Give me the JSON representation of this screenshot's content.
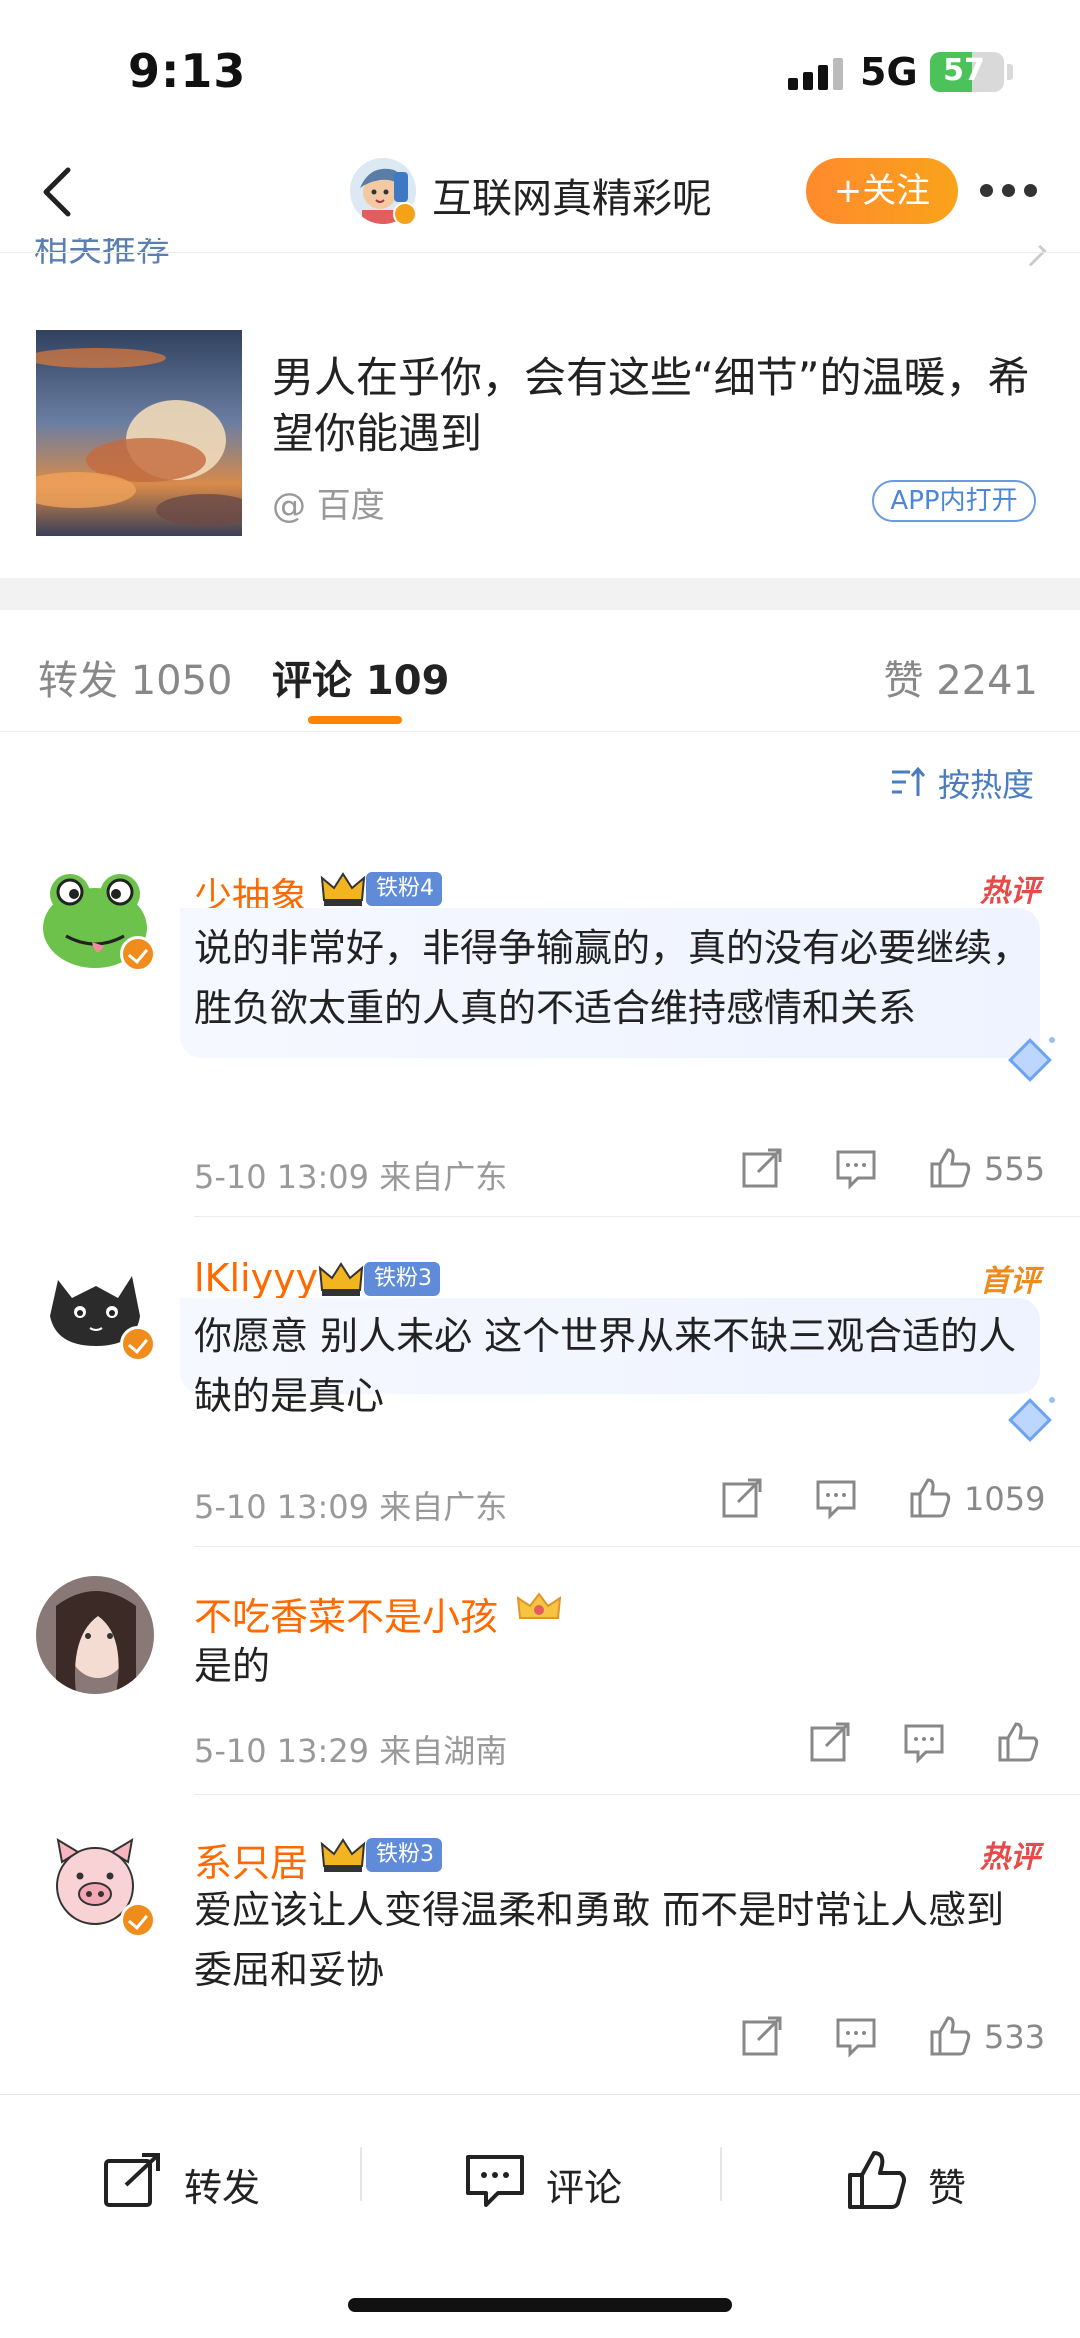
{
  "status_bar": {
    "time": "9:13",
    "network": "5G",
    "battery_level": "57",
    "battery_fraction": 0.57,
    "battery_color": "#4cc35a"
  },
  "nav": {
    "title": "互联网真精彩呢",
    "follow_label": "+关注",
    "follow_color": "#ff8a2c"
  },
  "related": {
    "header_partial": "相关推荐"
  },
  "recommendation": {
    "title": "男人在乎你，会有这些“细节”的温暖，希望你能遇到",
    "source": "@ 百度",
    "open_app_label": "APP内打开"
  },
  "tabs": {
    "repost": "转发 1050",
    "comments": "评论 109",
    "likes": "赞 2241",
    "active_color": "#ff8200"
  },
  "sort": {
    "label": "按热度"
  },
  "comments": [
    {
      "name": "少抽象",
      "fan_badge": "铁粉4",
      "hot_label": "热评",
      "text": "说的非常好，非得争输赢的，真的没有必要继续，胜负欲太重的人真的不适合维持感情和关系",
      "meta": "5-10 13:09 来自广东",
      "likes": "555"
    },
    {
      "name": "lKliyyy",
      "fan_badge": "铁粉3",
      "hot_label": "首评",
      "text": "你愿意 别人未必 这个世界从来不缺三观合适的人 缺的是真心",
      "meta": "5-10 13:09 来自广东",
      "likes": "1059"
    },
    {
      "name": "不吃香菜不是小孩",
      "text": "是的",
      "meta": "5-10 13:29 来自湖南",
      "likes": ""
    },
    {
      "name": "系只居",
      "fan_badge": "铁粉3",
      "hot_label": "热评",
      "text": "爱应该让人变得温柔和勇敢 而不是时常让人感到委屈和妥协",
      "meta": "",
      "likes": "533"
    }
  ],
  "bottom_bar": {
    "repost": "转发",
    "comment": "评论",
    "like": "赞"
  },
  "colors": {
    "name_orange": "#ff6a00",
    "link_blue": "#4a7dbf",
    "hot_red": "#e84a4a"
  }
}
